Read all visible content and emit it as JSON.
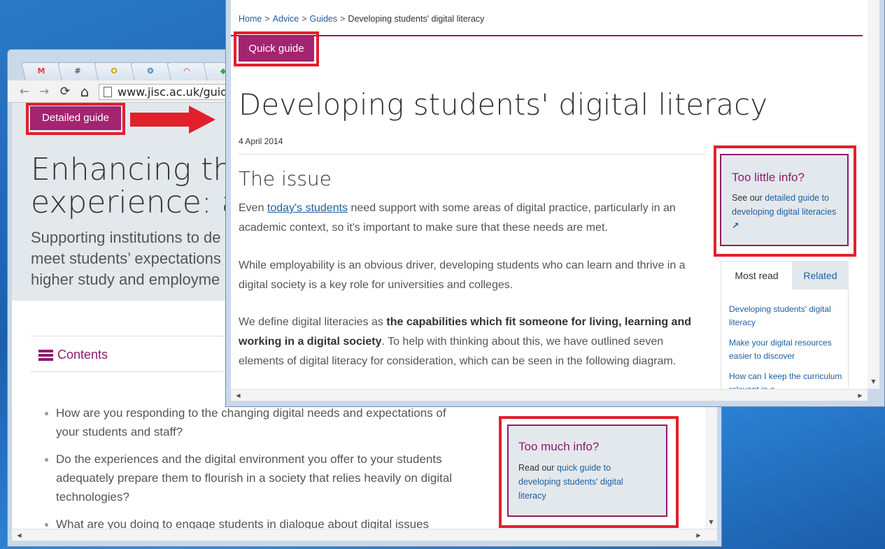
{
  "back_browser": {
    "tabs": [
      {
        "icon": "gmail-icon",
        "glyph": "M",
        "color": "#d44638"
      },
      {
        "icon": "hash-icon",
        "glyph": "#",
        "color": "#555555"
      },
      {
        "icon": "outlook-icon",
        "glyph": "O",
        "color": "#d9a400"
      },
      {
        "icon": "tree-icon",
        "glyph": "❂",
        "color": "#1e73be"
      },
      {
        "icon": "arc-icon",
        "glyph": "◠",
        "color": "#cc2222"
      },
      {
        "icon": "drive-icon",
        "glyph": "◆",
        "color": "#34a853"
      }
    ],
    "url": "www.jisc.ac.uk/guides/",
    "detailed_guide_button": "Detailed guide",
    "title": "Enhancing the\nexperience: a s",
    "subtitle": "Supporting institutions to de\nmeet students’ expectations\nhigher study and employme",
    "contents_label": "Contents",
    "bullets": [
      "How are you responding to the changing digital needs and expectations of your students and staff?",
      "Do the experiences and the digital environment you offer to your students adequately prepare them to flourish in a society that relies heavily on digital technologies?",
      "What are you doing to engage students in dialogue about digital issues"
    ],
    "too_much_info": {
      "title": "Too much info?",
      "text_prefix": "Read our ",
      "link": "quick guide to developing students' digital literacy"
    }
  },
  "front_browser": {
    "breadcrumb": [
      "Home",
      "Advice",
      "Guides"
    ],
    "breadcrumb_current": "Developing students' digital literacy",
    "breadcrumb_separator": ">",
    "quick_guide_button": "Quick guide",
    "title": "Developing students' digital literacy",
    "date": "4 April 2014",
    "issue_heading": "The issue",
    "para1_prefix": "Even ",
    "para1_link": "today's students",
    "para1_rest": " need support with some areas of digital practice, particularly in an academic context, so it's important to make sure that these needs are met.",
    "para2": "While employability is an obvious driver, developing students who can learn and thrive in a digital society is a key role for universities and colleges.",
    "para3_prefix": "We define digital literacies as ",
    "para3_bold": "the capabilities which fit someone for living, learning and working in a digital society",
    "para3_rest": ". To help with thinking about this, we have outlined seven elements of digital literacy for consideration, which can be seen in the following diagram.",
    "too_little_info": {
      "title": "Too little info?",
      "text_prefix": "See our ",
      "link": "detailed guide to developing digital literacies",
      "external_glyph": "↗"
    },
    "tabs": {
      "most_read": "Most read",
      "related": "Related"
    },
    "most_read_links": [
      "Developing students' digital literacy",
      "Make your digital resources easier to discover",
      "How can I keep the curriculum relevant in a"
    ]
  },
  "colors": {
    "accent_purple": "#a3246f",
    "highlight_red": "#e2202b",
    "link_blue": "#1f5f9e"
  },
  "icons": {
    "back": "←",
    "forward": "→",
    "reload": "⟳",
    "home": "⌂",
    "scroll_up": "▲",
    "scroll_down": "▼",
    "scroll_left": "◀",
    "scroll_right": "▶"
  }
}
